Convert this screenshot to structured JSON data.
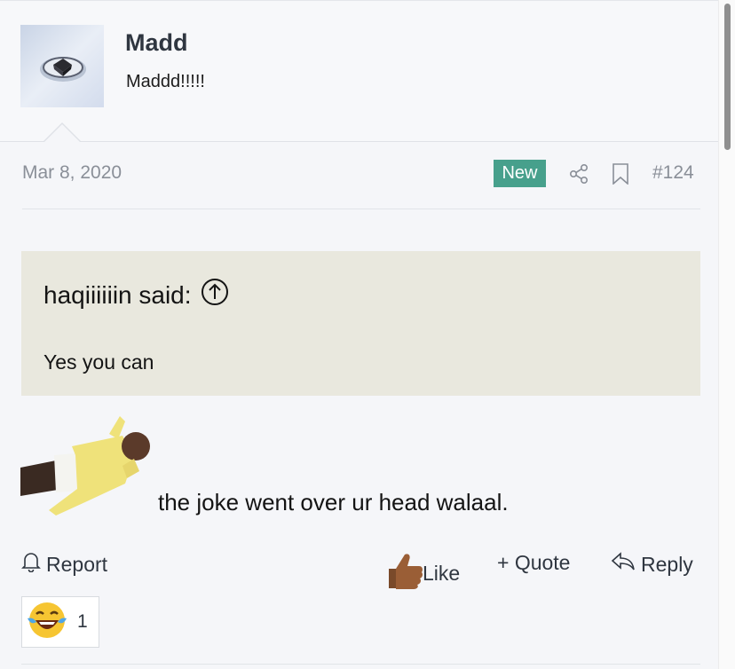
{
  "user": {
    "name": "Madd",
    "title": "Maddd!!!!!"
  },
  "post": {
    "date": "Mar 8, 2020",
    "badge": "New",
    "number": "#124",
    "share_icon": "share-icon",
    "bookmark_icon": "bookmark-icon"
  },
  "quote": {
    "author": "haqiiiiiin said:",
    "text": "Yes you can",
    "jump_icon": "arrow-circle-up-icon"
  },
  "message": {
    "text": "the joke went over ur head walaal."
  },
  "actions": {
    "report": "Report",
    "like": "Like",
    "quote": "+ Quote",
    "reply": "Reply"
  },
  "reactions": {
    "emoji": "laughing-tears",
    "count": "1"
  },
  "colors": {
    "badge": "#47a08c",
    "quote_bg": "#e9e8de",
    "post_bg": "#f5f6f9"
  }
}
